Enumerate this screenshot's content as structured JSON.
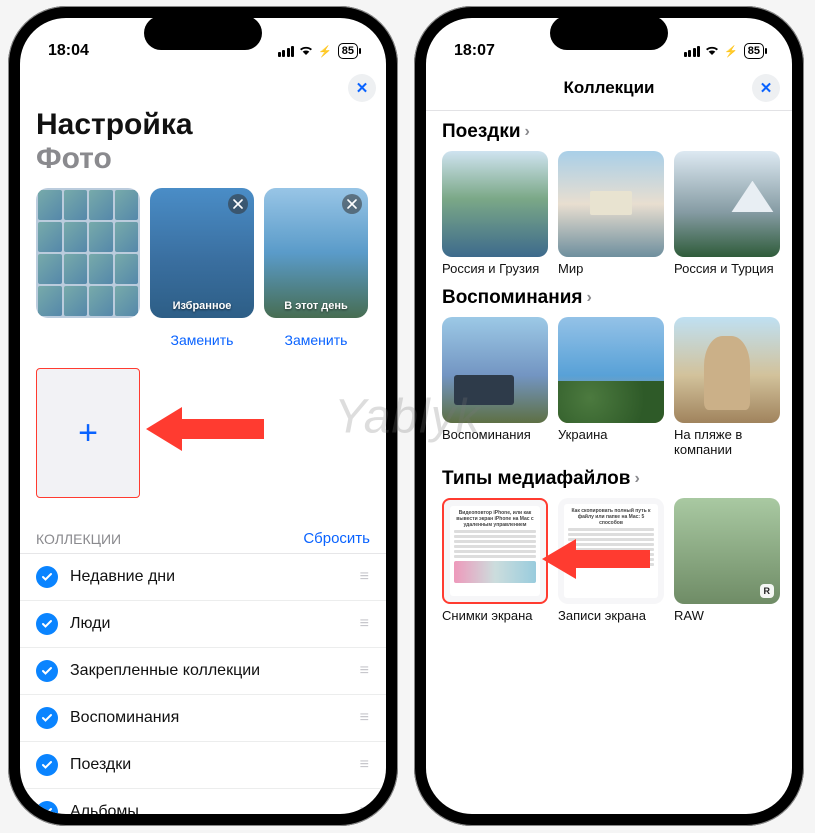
{
  "watermark": "Yablyk",
  "left": {
    "time": "18:04",
    "battery": "85",
    "title": "Настройка",
    "subtitle": "Фото",
    "tiles": {
      "fav_label": "Избранное",
      "day_label": "В этот день"
    },
    "replace_label": "Заменить",
    "collections_header": "КОЛЛЕКЦИИ",
    "reset_label": "Сбросить",
    "items": [
      "Недавние дни",
      "Люди",
      "Закрепленные коллекции",
      "Воспоминания",
      "Поездки",
      "Альбомы"
    ]
  },
  "right": {
    "time": "18:07",
    "battery": "85",
    "nav_title": "Коллекции",
    "sections": {
      "trips": "Поездки",
      "memories": "Воспоминания",
      "media": "Типы медиафайлов"
    },
    "trips_items": [
      "Россия и Грузия",
      "Мир",
      "Россия и Турция"
    ],
    "memories_items": [
      "Воспоминания",
      "Украина",
      "На пляже в компании"
    ],
    "media_items": [
      "Снимки экрана",
      "Записи экрана",
      "RAW"
    ],
    "raw_badge": "R"
  }
}
